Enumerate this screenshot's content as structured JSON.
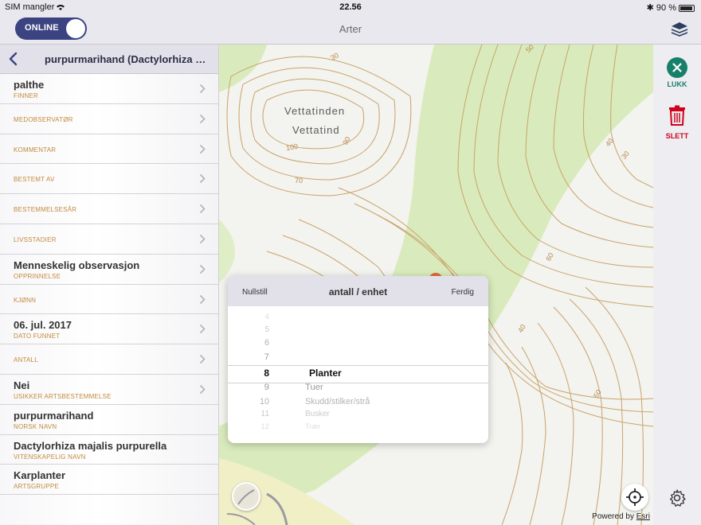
{
  "status": {
    "carrier": "SIM mangler",
    "time": "22.56",
    "battery": "90 %"
  },
  "nav": {
    "online_label": "ONLINE",
    "title": "Arter"
  },
  "panel": {
    "title": "purpurmarihand (Dactylorhiza majalis purpurella)",
    "rows": [
      {
        "value": "palthe",
        "label": "FINNER"
      },
      {
        "value": "",
        "label": "MEDOBSERVATØR"
      },
      {
        "value": "",
        "label": "KOMMENTAR"
      },
      {
        "value": "",
        "label": "BESTEMT AV"
      },
      {
        "value": "",
        "label": "BESTEMMELSESÅR"
      },
      {
        "value": "",
        "label": "LIVSSTADIER"
      },
      {
        "value": "Menneskelig observasjon",
        "label": "OPPRINNELSE"
      },
      {
        "value": "",
        "label": "KJØNN"
      },
      {
        "value": "06. jul. 2017",
        "label": "DATO FUNNET"
      },
      {
        "value": "",
        "label": "ANTALL"
      },
      {
        "value": "Nei",
        "label": "USIKKER ARTSBESTEMMELSE"
      },
      {
        "value": "purpurmarihand",
        "label": "NORSK NAVN"
      },
      {
        "value": "Dactylorhiza majalis purpurella",
        "label": "VITENSKAPELIG NAVN"
      },
      {
        "value": "Karplanter",
        "label": "ARTSGRUPPE"
      }
    ]
  },
  "map": {
    "place_names": [
      "Vettatinden",
      "Vettatind"
    ],
    "contour_labels": [
      "100",
      "70",
      "90",
      "50",
      "40",
      "60",
      "30",
      "40",
      "50",
      "30"
    ],
    "attribution": "Powered by",
    "attribution_link": "Esri"
  },
  "picker": {
    "reset": "Nullstill",
    "title": "antall / enhet",
    "done": "Ferdig",
    "numbers": [
      "4",
      "5",
      "6",
      "7",
      "8",
      "9",
      "10",
      "11",
      "12"
    ],
    "selected_number": "8",
    "units": [
      "Planter",
      "Tuer",
      "Skudd/stilker/strå",
      "Busker",
      "Trær"
    ],
    "selected_unit": "Planter"
  },
  "tools": {
    "close_label": "LUKK",
    "delete_label": "SLETT"
  },
  "colors": {
    "accent": "#3b4381",
    "label": "#c28a3c",
    "close": "#17806a",
    "delete": "#d0021b",
    "park": "#d5e8b0",
    "contour": "#c9a36a"
  }
}
